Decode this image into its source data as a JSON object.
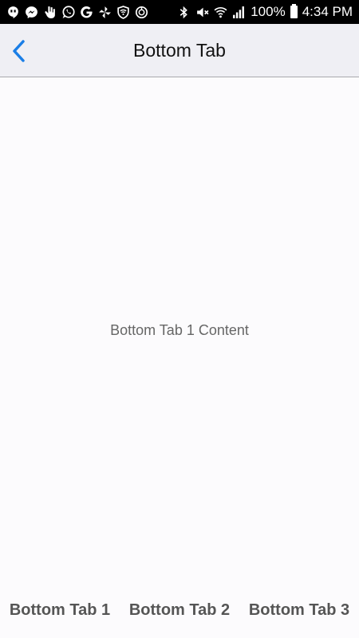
{
  "status_bar": {
    "left_icons": [
      "hangouts-icon",
      "messenger-icon",
      "hand-icon",
      "whatsapp-icon",
      "google-icon",
      "pinwheel-icon",
      "vpn-shield-icon",
      "sync-icon"
    ],
    "right_icons": [
      "bluetooth-icon",
      "mute-icon",
      "wifi-icon",
      "signal-icon"
    ],
    "battery_percent": "100%",
    "time": "4:34 PM"
  },
  "nav": {
    "title": "Bottom Tab",
    "back_icon": "chevron-left-icon",
    "accent": "#1a7ee6"
  },
  "content": {
    "text": "Bottom Tab 1 Content"
  },
  "tabs": [
    {
      "label": "Bottom Tab 1",
      "active": true
    },
    {
      "label": "Bottom Tab 2",
      "active": false
    },
    {
      "label": "Bottom Tab 3",
      "active": false
    }
  ],
  "colors": {
    "indicator": "#e35f56",
    "nav_background": "#efeff4",
    "page_background": "#fcfbfd"
  }
}
